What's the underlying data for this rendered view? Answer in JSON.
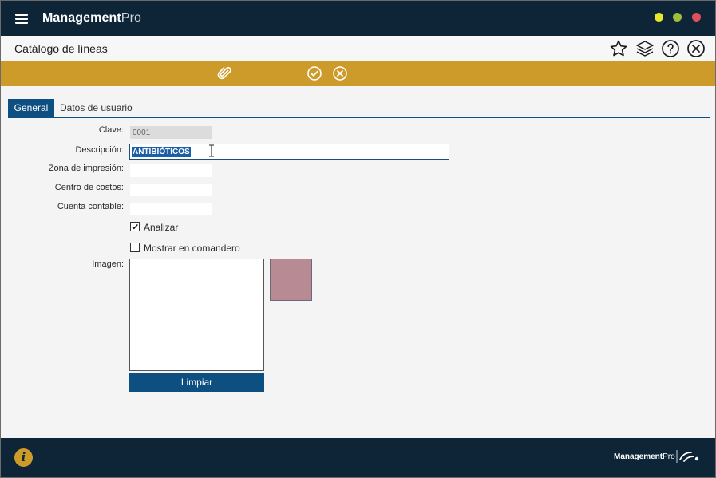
{
  "app": {
    "brand_bold": "Management",
    "brand_light": "Pro"
  },
  "window_controls": [
    "minimize",
    "maximize",
    "close"
  ],
  "colors": {
    "titlebar": "#0e2538",
    "toolbar": "#cc9b2a",
    "accent": "#0e4f82",
    "image_swatch": "#b88b94"
  },
  "page": {
    "title": "Catálogo de líneas",
    "header_icons": [
      "star-icon",
      "layers-icon",
      "help-icon",
      "close-icon"
    ]
  },
  "toolbar": {
    "icons": [
      "paperclip-icon",
      "check-circle-icon",
      "cancel-circle-icon"
    ]
  },
  "tabs": [
    {
      "label": "General",
      "active": true
    },
    {
      "label": "Datos de usuario",
      "active": false
    }
  ],
  "form": {
    "clave": {
      "label": "Clave:",
      "value": "0001"
    },
    "descripcion": {
      "label": "Descripción:",
      "value": "ANTIBIÓTICOS"
    },
    "zona_impresion": {
      "label": "Zona de impresión:",
      "value": ""
    },
    "centro_costos": {
      "label": "Centro de costos:",
      "value": ""
    },
    "cuenta_contable": {
      "label": "Cuenta contable:",
      "value": ""
    },
    "analizar": {
      "label": "Analizar",
      "checked": true
    },
    "mostrar_comandero": {
      "label": "Mostrar en comandero",
      "checked": false
    },
    "imagen": {
      "label": "Imagen:"
    },
    "limpiar_button": "Limpiar"
  },
  "footer": {
    "brand_bold": "Management",
    "brand_light": "Pro"
  }
}
